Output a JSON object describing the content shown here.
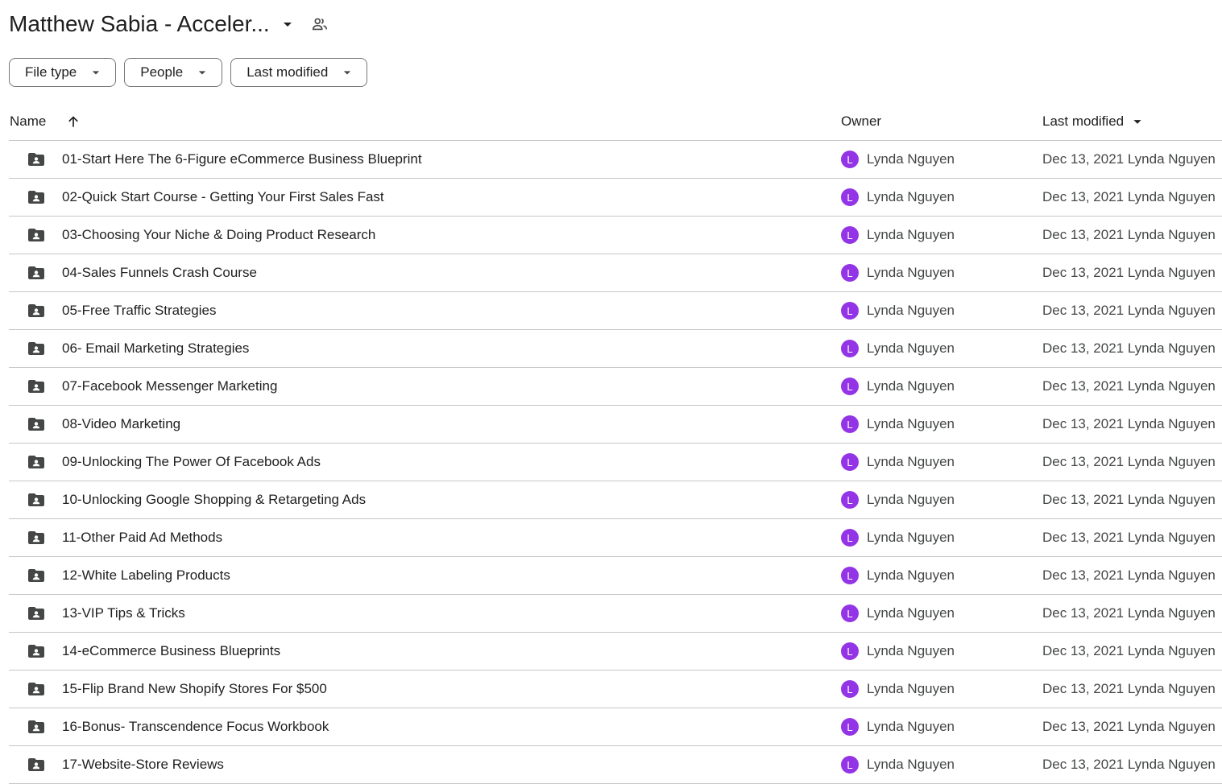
{
  "header": {
    "title": "Matthew Sabia - Acceler...",
    "title_caret_icon": "arrow-drop-down-icon",
    "shared_icon": "people-icon"
  },
  "filters": [
    {
      "label": "File type"
    },
    {
      "label": "People"
    },
    {
      "label": "Last modified"
    }
  ],
  "columns": {
    "name": "Name",
    "owner": "Owner",
    "last_modified": "Last modified",
    "sort_icon": "arrow-upward-icon"
  },
  "colors": {
    "avatar": "#9334e6",
    "border": "#c4c7c5",
    "text": "#1f1f1f",
    "muted": "#444746"
  },
  "rows": [
    {
      "name": "01-Start Here The 6-Figure eCommerce Business Blueprint",
      "owner": "Lynda Nguyen",
      "avatar": "L",
      "modified": "Dec 13, 2021 Lynda Nguyen"
    },
    {
      "name": "02-Quick Start Course - Getting Your First Sales Fast",
      "owner": "Lynda Nguyen",
      "avatar": "L",
      "modified": "Dec 13, 2021 Lynda Nguyen"
    },
    {
      "name": "03-Choosing Your Niche & Doing Product Research",
      "owner": "Lynda Nguyen",
      "avatar": "L",
      "modified": "Dec 13, 2021 Lynda Nguyen"
    },
    {
      "name": "04-Sales Funnels Crash Course",
      "owner": "Lynda Nguyen",
      "avatar": "L",
      "modified": "Dec 13, 2021 Lynda Nguyen"
    },
    {
      "name": "05-Free Traffic Strategies",
      "owner": "Lynda Nguyen",
      "avatar": "L",
      "modified": "Dec 13, 2021 Lynda Nguyen"
    },
    {
      "name": "06- Email Marketing Strategies",
      "owner": "Lynda Nguyen",
      "avatar": "L",
      "modified": "Dec 13, 2021 Lynda Nguyen"
    },
    {
      "name": "07-Facebook Messenger Marketing",
      "owner": "Lynda Nguyen",
      "avatar": "L",
      "modified": "Dec 13, 2021 Lynda Nguyen"
    },
    {
      "name": "08-Video Marketing",
      "owner": "Lynda Nguyen",
      "avatar": "L",
      "modified": "Dec 13, 2021 Lynda Nguyen"
    },
    {
      "name": "09-Unlocking The Power Of Facebook Ads",
      "owner": "Lynda Nguyen",
      "avatar": "L",
      "modified": "Dec 13, 2021 Lynda Nguyen"
    },
    {
      "name": "10-Unlocking Google Shopping & Retargeting Ads",
      "owner": "Lynda Nguyen",
      "avatar": "L",
      "modified": "Dec 13, 2021 Lynda Nguyen"
    },
    {
      "name": "11-Other Paid Ad Methods",
      "owner": "Lynda Nguyen",
      "avatar": "L",
      "modified": "Dec 13, 2021 Lynda Nguyen"
    },
    {
      "name": "12-White Labeling Products",
      "owner": "Lynda Nguyen",
      "avatar": "L",
      "modified": "Dec 13, 2021 Lynda Nguyen"
    },
    {
      "name": "13-VIP Tips & Tricks",
      "owner": "Lynda Nguyen",
      "avatar": "L",
      "modified": "Dec 13, 2021 Lynda Nguyen"
    },
    {
      "name": "14-eCommerce Business Blueprints",
      "owner": "Lynda Nguyen",
      "avatar": "L",
      "modified": "Dec 13, 2021 Lynda Nguyen"
    },
    {
      "name": "15-Flip Brand New Shopify Stores For $500",
      "owner": "Lynda Nguyen",
      "avatar": "L",
      "modified": "Dec 13, 2021 Lynda Nguyen"
    },
    {
      "name": "16-Bonus- Transcendence Focus Workbook",
      "owner": "Lynda Nguyen",
      "avatar": "L",
      "modified": "Dec 13, 2021 Lynda Nguyen"
    },
    {
      "name": "17-Website-Store Reviews",
      "owner": "Lynda Nguyen",
      "avatar": "L",
      "modified": "Dec 13, 2021 Lynda Nguyen"
    }
  ]
}
